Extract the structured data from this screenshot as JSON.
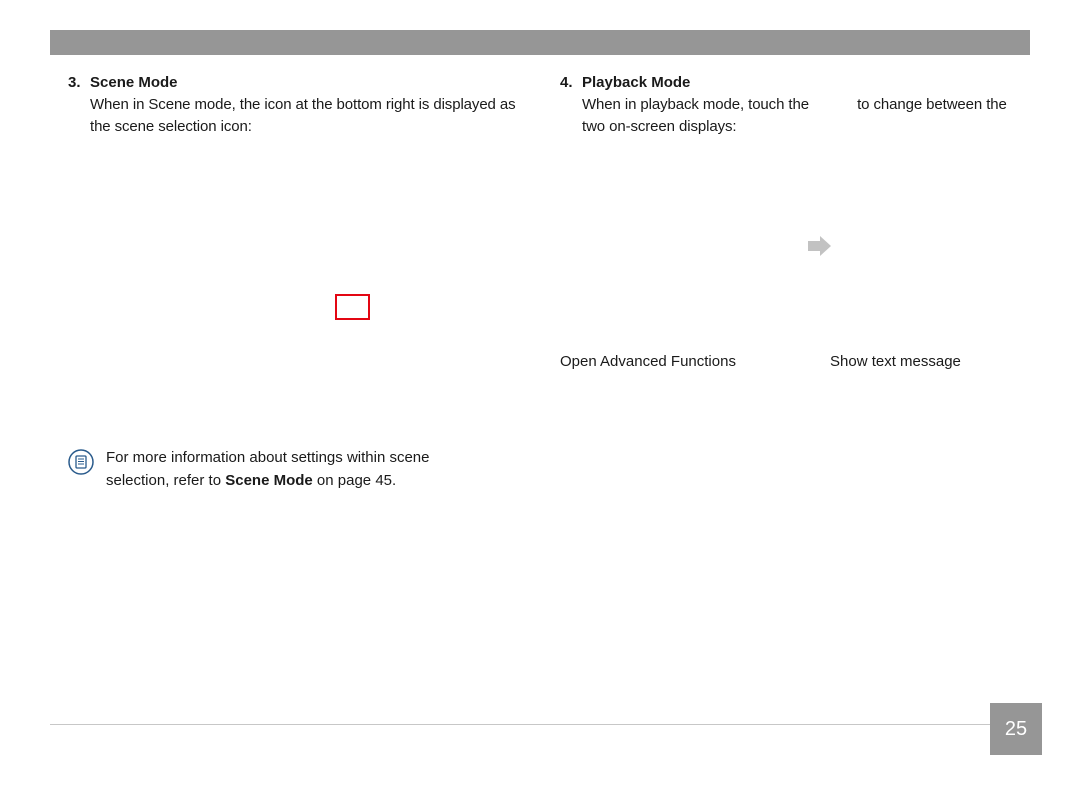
{
  "left": {
    "num": "3.",
    "title": "Scene Mode",
    "desc": "When in Scene mode, the icon at the bottom right is displayed as the scene selection icon:"
  },
  "right": {
    "num": "4.",
    "title": "Playback Mode",
    "desc_part1": "When in playback mode, touch the",
    "desc_part2": "to change between the two on-screen displays:"
  },
  "captions": {
    "left": "Open Advanced Functions",
    "right": "Show text message"
  },
  "note": {
    "text_prefix": "For more information about settings within scene selection, refer to ",
    "ref_label": "Scene Mode",
    "text_suffix": " on page 45."
  },
  "page_number": "25"
}
